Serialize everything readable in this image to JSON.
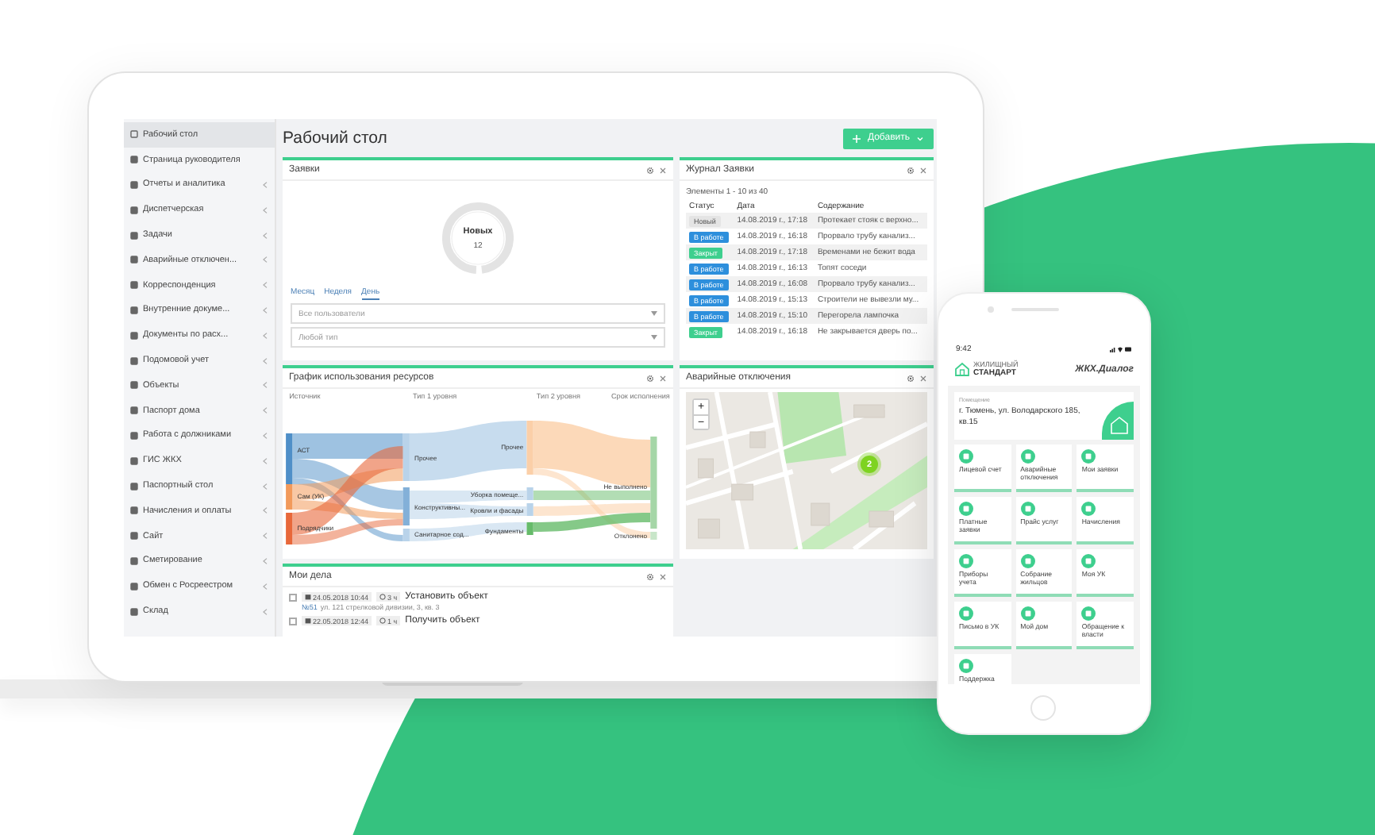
{
  "sidebar": {
    "items": [
      {
        "label": "Рабочий стол",
        "selected": true,
        "has_submenu": false
      },
      {
        "label": "Страница руководителя",
        "selected": false,
        "has_submenu": false
      },
      {
        "label": "Отчеты и аналитика",
        "selected": false,
        "has_submenu": true
      },
      {
        "label": "Диспетчерская",
        "selected": false,
        "has_submenu": true
      },
      {
        "label": "Задачи",
        "selected": false,
        "has_submenu": true
      },
      {
        "label": "Аварийные отключен...",
        "selected": false,
        "has_submenu": true
      },
      {
        "label": "Корреспонденция",
        "selected": false,
        "has_submenu": true
      },
      {
        "label": "Внутренние докуме...",
        "selected": false,
        "has_submenu": true
      },
      {
        "label": "Документы по расх...",
        "selected": false,
        "has_submenu": true
      },
      {
        "label": "Подомовой учет",
        "selected": false,
        "has_submenu": true
      },
      {
        "label": "Объекты",
        "selected": false,
        "has_submenu": true
      },
      {
        "label": "Паспорт дома",
        "selected": false,
        "has_submenu": true
      },
      {
        "label": "Работа с должниками",
        "selected": false,
        "has_submenu": true
      },
      {
        "label": "ГИС ЖКХ",
        "selected": false,
        "has_submenu": true
      },
      {
        "label": "Паспортный стол",
        "selected": false,
        "has_submenu": true
      },
      {
        "label": "Начисления и оплаты",
        "selected": false,
        "has_submenu": true
      },
      {
        "label": "Сайт",
        "selected": false,
        "has_submenu": true
      },
      {
        "label": "Сметирование",
        "selected": false,
        "has_submenu": true
      },
      {
        "label": "Обмен с Росреестром",
        "selected": false,
        "has_submenu": true
      },
      {
        "label": "Склад",
        "selected": false,
        "has_submenu": true
      }
    ]
  },
  "page_title": "Рабочий стол",
  "add_button": {
    "label": "Добавить"
  },
  "requests_panel": {
    "title": "Заявки",
    "donut": {
      "label": "Новых",
      "count": "12"
    },
    "tabs": [
      {
        "label": "Месяц",
        "selected": false
      },
      {
        "label": "Неделя",
        "selected": false
      },
      {
        "label": "День",
        "selected": true
      }
    ],
    "filters": [
      {
        "placeholder": "Все пользователи"
      },
      {
        "placeholder": "Любой тип"
      }
    ]
  },
  "journal": {
    "title": "Журнал Заявки",
    "summary": "Элементы 1 - 10 из 40",
    "columns": [
      "Статус",
      "Дата",
      "Содержание"
    ],
    "rows": [
      {
        "status": "Новый",
        "kind": "new",
        "date": "14.08.2019 г., 17:18",
        "text": "Протекает стояк с верхно..."
      },
      {
        "status": "В работе",
        "kind": "in_progress",
        "date": "14.08.2019 г., 16:18",
        "text": "Прорвало трубу канализ..."
      },
      {
        "status": "Закрыт",
        "kind": "closed",
        "date": "14.08.2019 г., 17:18",
        "text": "Временами не бежит вода"
      },
      {
        "status": "В работе",
        "kind": "in_progress",
        "date": "14.08.2019 г., 16:13",
        "text": "Топят соседи"
      },
      {
        "status": "В работе",
        "kind": "in_progress",
        "date": "14.08.2019 г., 16:08",
        "text": "Прорвало трубу канализ..."
      },
      {
        "status": "В работе",
        "kind": "in_progress",
        "date": "14.08.2019 г., 15:13",
        "text": "Строители не вывезли му..."
      },
      {
        "status": "В работе",
        "kind": "in_progress",
        "date": "14.08.2019 г., 15:10",
        "text": "Перегорела лампочка"
      },
      {
        "status": "Закрыт",
        "kind": "closed",
        "date": "14.08.2019 г., 16:18",
        "text": "Не закрывается дверь по..."
      }
    ]
  },
  "resources": {
    "title": "График использования ресурсов",
    "columns": [
      "Источник",
      "Тип 1 уровня",
      "Тип 2 уровня",
      "Срок исполнения"
    ],
    "sources": [
      "АСТ",
      "Сам (УК)",
      "Подрядчики"
    ],
    "level1": [
      "Прочее",
      "Конструктивны...",
      "Санитарное сод..."
    ],
    "level2": [
      "Прочее",
      "Уборка помеще...",
      "Кровли и фасады",
      "Фундаменты"
    ],
    "results": [
      "Не выполнено",
      "Отклонено"
    ]
  },
  "outages": {
    "title": "Аварийные отключения",
    "zoom_in": "+",
    "zoom_out": "−",
    "cluster": "2"
  },
  "tasks": {
    "title": "Мои дела",
    "items": [
      {
        "checked": false,
        "date": "24.05.2018 10:44",
        "duration": "3 ч",
        "title": "Установить объект",
        "code": "№51",
        "address": "ул. 121 стрелковой дивизии, 3, кв. 3"
      },
      {
        "checked": false,
        "date": "22.05.2018 12:44",
        "duration": "1 ч",
        "title": "Получить объект"
      }
    ]
  },
  "phone": {
    "time": "9:42",
    "brand_top": "ЖИЛИЩНЫЙ",
    "brand_bottom": "СТАНДАРТ",
    "app_name": "ЖКХ.Диалог",
    "premises": {
      "label": "Помещение",
      "address": "г. Тюмень, ул. Володарского 185, кв.15"
    },
    "tiles": [
      "Лицевой счет",
      "Аварийные отключения",
      "Мои заявки",
      "Платные заявки",
      "Прайс услуг",
      "Начисления",
      "Приборы учета",
      "Собрание жильцов",
      "Моя УК",
      "Письмо в УК",
      "Мой дом",
      "Обращение к власти",
      "Поддержка"
    ]
  }
}
